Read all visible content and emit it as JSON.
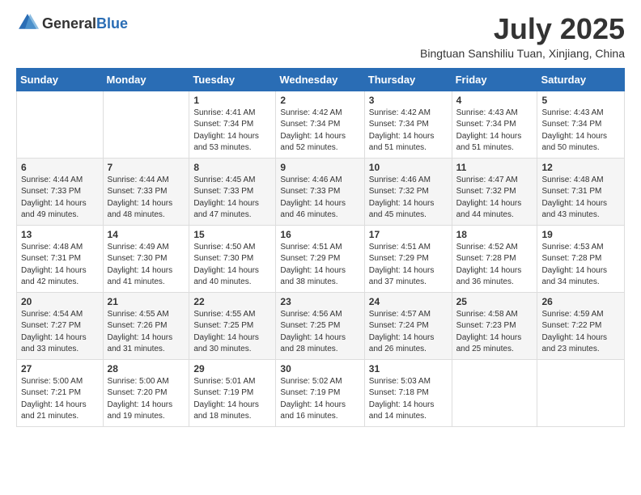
{
  "header": {
    "logo_line1": "General",
    "logo_line2": "Blue",
    "month_year": "July 2025",
    "location": "Bingtuan Sanshiliu Tuan, Xinjiang, China"
  },
  "weekdays": [
    "Sunday",
    "Monday",
    "Tuesday",
    "Wednesday",
    "Thursday",
    "Friday",
    "Saturday"
  ],
  "weeks": [
    [
      {
        "day": "",
        "info": ""
      },
      {
        "day": "",
        "info": ""
      },
      {
        "day": "1",
        "info": "Sunrise: 4:41 AM\nSunset: 7:34 PM\nDaylight: 14 hours and 53 minutes."
      },
      {
        "day": "2",
        "info": "Sunrise: 4:42 AM\nSunset: 7:34 PM\nDaylight: 14 hours and 52 minutes."
      },
      {
        "day": "3",
        "info": "Sunrise: 4:42 AM\nSunset: 7:34 PM\nDaylight: 14 hours and 51 minutes."
      },
      {
        "day": "4",
        "info": "Sunrise: 4:43 AM\nSunset: 7:34 PM\nDaylight: 14 hours and 51 minutes."
      },
      {
        "day": "5",
        "info": "Sunrise: 4:43 AM\nSunset: 7:34 PM\nDaylight: 14 hours and 50 minutes."
      }
    ],
    [
      {
        "day": "6",
        "info": "Sunrise: 4:44 AM\nSunset: 7:33 PM\nDaylight: 14 hours and 49 minutes."
      },
      {
        "day": "7",
        "info": "Sunrise: 4:44 AM\nSunset: 7:33 PM\nDaylight: 14 hours and 48 minutes."
      },
      {
        "day": "8",
        "info": "Sunrise: 4:45 AM\nSunset: 7:33 PM\nDaylight: 14 hours and 47 minutes."
      },
      {
        "day": "9",
        "info": "Sunrise: 4:46 AM\nSunset: 7:33 PM\nDaylight: 14 hours and 46 minutes."
      },
      {
        "day": "10",
        "info": "Sunrise: 4:46 AM\nSunset: 7:32 PM\nDaylight: 14 hours and 45 minutes."
      },
      {
        "day": "11",
        "info": "Sunrise: 4:47 AM\nSunset: 7:32 PM\nDaylight: 14 hours and 44 minutes."
      },
      {
        "day": "12",
        "info": "Sunrise: 4:48 AM\nSunset: 7:31 PM\nDaylight: 14 hours and 43 minutes."
      }
    ],
    [
      {
        "day": "13",
        "info": "Sunrise: 4:48 AM\nSunset: 7:31 PM\nDaylight: 14 hours and 42 minutes."
      },
      {
        "day": "14",
        "info": "Sunrise: 4:49 AM\nSunset: 7:30 PM\nDaylight: 14 hours and 41 minutes."
      },
      {
        "day": "15",
        "info": "Sunrise: 4:50 AM\nSunset: 7:30 PM\nDaylight: 14 hours and 40 minutes."
      },
      {
        "day": "16",
        "info": "Sunrise: 4:51 AM\nSunset: 7:29 PM\nDaylight: 14 hours and 38 minutes."
      },
      {
        "day": "17",
        "info": "Sunrise: 4:51 AM\nSunset: 7:29 PM\nDaylight: 14 hours and 37 minutes."
      },
      {
        "day": "18",
        "info": "Sunrise: 4:52 AM\nSunset: 7:28 PM\nDaylight: 14 hours and 36 minutes."
      },
      {
        "day": "19",
        "info": "Sunrise: 4:53 AM\nSunset: 7:28 PM\nDaylight: 14 hours and 34 minutes."
      }
    ],
    [
      {
        "day": "20",
        "info": "Sunrise: 4:54 AM\nSunset: 7:27 PM\nDaylight: 14 hours and 33 minutes."
      },
      {
        "day": "21",
        "info": "Sunrise: 4:55 AM\nSunset: 7:26 PM\nDaylight: 14 hours and 31 minutes."
      },
      {
        "day": "22",
        "info": "Sunrise: 4:55 AM\nSunset: 7:25 PM\nDaylight: 14 hours and 30 minutes."
      },
      {
        "day": "23",
        "info": "Sunrise: 4:56 AM\nSunset: 7:25 PM\nDaylight: 14 hours and 28 minutes."
      },
      {
        "day": "24",
        "info": "Sunrise: 4:57 AM\nSunset: 7:24 PM\nDaylight: 14 hours and 26 minutes."
      },
      {
        "day": "25",
        "info": "Sunrise: 4:58 AM\nSunset: 7:23 PM\nDaylight: 14 hours and 25 minutes."
      },
      {
        "day": "26",
        "info": "Sunrise: 4:59 AM\nSunset: 7:22 PM\nDaylight: 14 hours and 23 minutes."
      }
    ],
    [
      {
        "day": "27",
        "info": "Sunrise: 5:00 AM\nSunset: 7:21 PM\nDaylight: 14 hours and 21 minutes."
      },
      {
        "day": "28",
        "info": "Sunrise: 5:00 AM\nSunset: 7:20 PM\nDaylight: 14 hours and 19 minutes."
      },
      {
        "day": "29",
        "info": "Sunrise: 5:01 AM\nSunset: 7:19 PM\nDaylight: 14 hours and 18 minutes."
      },
      {
        "day": "30",
        "info": "Sunrise: 5:02 AM\nSunset: 7:19 PM\nDaylight: 14 hours and 16 minutes."
      },
      {
        "day": "31",
        "info": "Sunrise: 5:03 AM\nSunset: 7:18 PM\nDaylight: 14 hours and 14 minutes."
      },
      {
        "day": "",
        "info": ""
      },
      {
        "day": "",
        "info": ""
      }
    ]
  ]
}
